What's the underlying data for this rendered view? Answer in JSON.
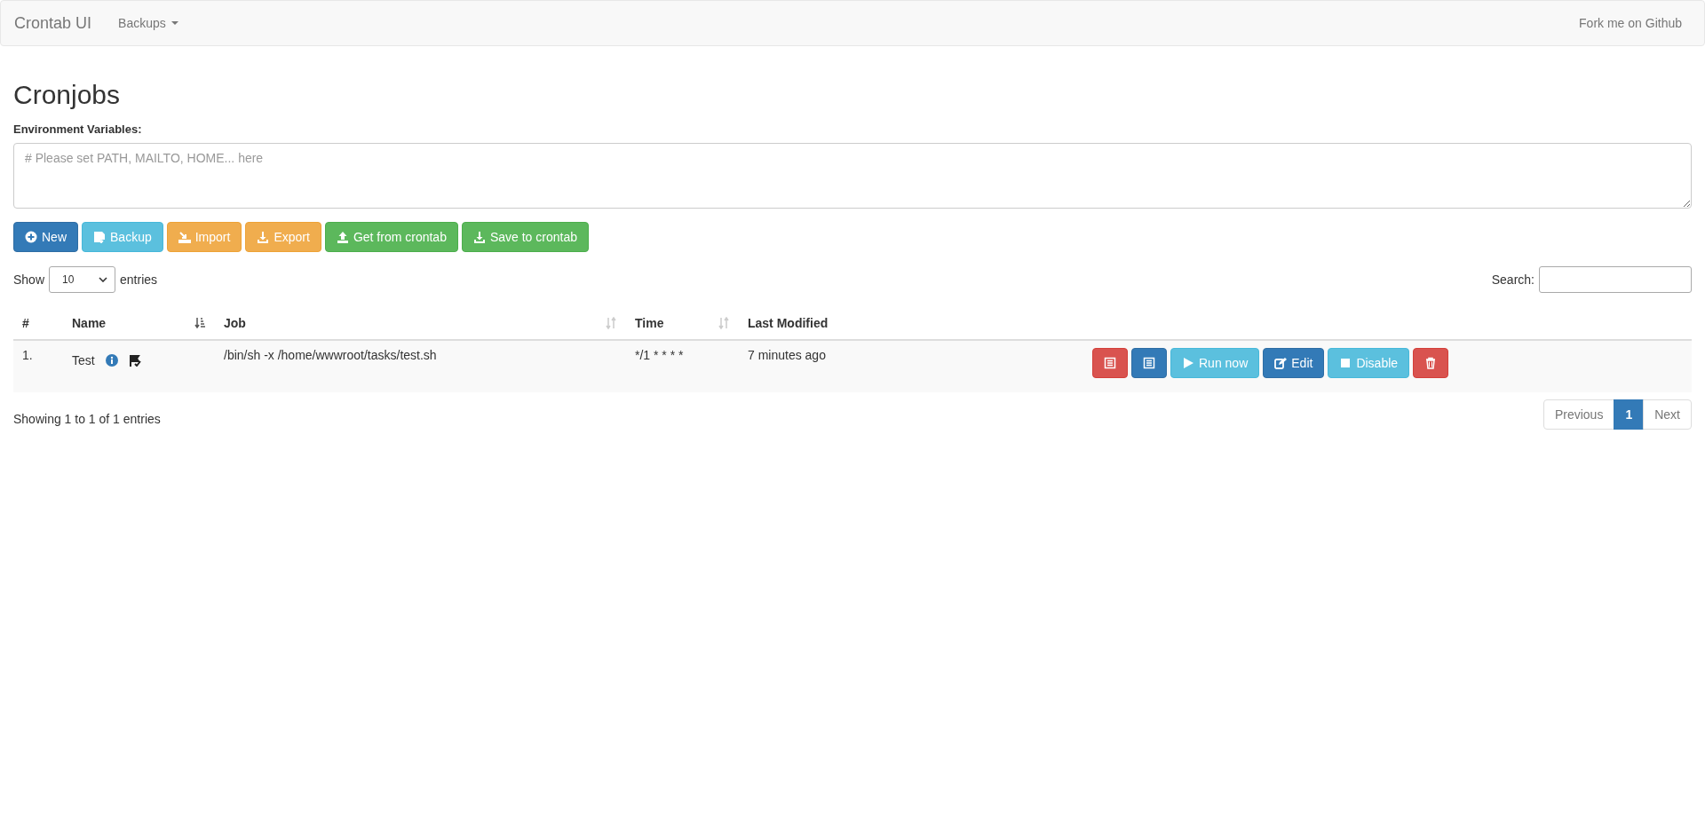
{
  "navbar": {
    "brand": "Crontab UI",
    "menu": {
      "label": "Backups"
    },
    "right_link": "Fork me on Github"
  },
  "heading": "Cronjobs",
  "env": {
    "label": "Environment Variables:",
    "placeholder": "# Please set PATH, MAILTO, HOME... here"
  },
  "toolbar": [
    {
      "label": "New",
      "kind": "new"
    },
    {
      "label": "Backup",
      "kind": "backup"
    },
    {
      "label": "Import",
      "kind": "import"
    },
    {
      "label": "Export",
      "kind": "export"
    },
    {
      "label": "Get from crontab",
      "kind": "get"
    },
    {
      "label": "Save to crontab",
      "kind": "save"
    }
  ],
  "length": {
    "before": "Show",
    "value": "10",
    "after": "entries"
  },
  "search": {
    "label": "Search:"
  },
  "table": {
    "columns": [
      {
        "label": "#"
      },
      {
        "label": "Name",
        "sorted": true
      },
      {
        "label": "Job",
        "sorted": false
      },
      {
        "label": "Time",
        "sorted": false
      },
      {
        "label": "Last Modified"
      }
    ],
    "rows": [
      {
        "index": "1.",
        "name": "Test",
        "job": "/bin/sh -x /home/wwwroot/tasks/test.sh",
        "time": "*/1 * * * *",
        "modified": "7 minutes ago",
        "actions": [
          {
            "kind": "error_log"
          },
          {
            "kind": "log"
          },
          {
            "label": "Run now",
            "kind": "run"
          },
          {
            "label": "Edit",
            "kind": "edit"
          },
          {
            "label": "Disable",
            "kind": "disable"
          },
          {
            "kind": "delete"
          }
        ]
      }
    ]
  },
  "info": "Showing 1 to 1 of 1 entries",
  "pagination": [
    {
      "label": "Previous",
      "selected": false
    },
    {
      "label": "1",
      "selected": true
    },
    {
      "label": "Next",
      "selected": false
    }
  ]
}
